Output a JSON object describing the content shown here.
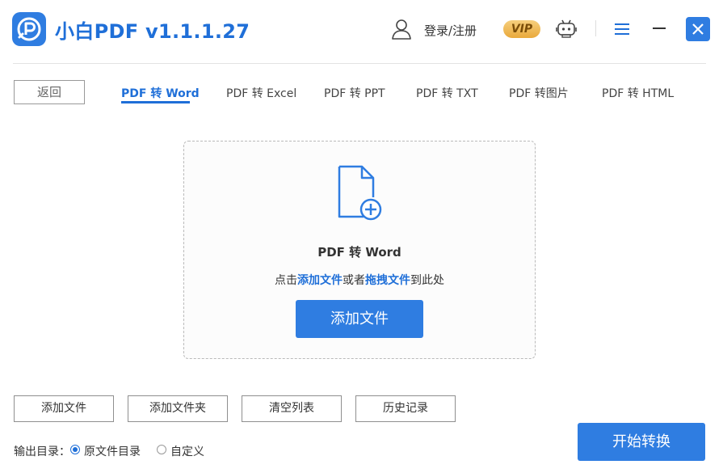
{
  "app": {
    "title": "小白PDF v1.1.1.27"
  },
  "header": {
    "login_label": "登录/注册",
    "vip_label": "VIP"
  },
  "nav": {
    "back_label": "返回",
    "tabs": [
      {
        "label": "PDF 转 Word",
        "active": true
      },
      {
        "label": "PDF 转 Excel",
        "active": false
      },
      {
        "label": "PDF 转 PPT",
        "active": false
      },
      {
        "label": "PDF 转 TXT",
        "active": false
      },
      {
        "label": "PDF 转图片",
        "active": false
      },
      {
        "label": "PDF 转 HTML",
        "active": false
      }
    ]
  },
  "dropzone": {
    "title": "PDF 转 Word",
    "hint_prefix": "点击",
    "hint_add": "添加文件",
    "hint_mid": "或者",
    "hint_drag": "拖拽文件",
    "hint_suffix": "到此处",
    "add_button": "添加文件"
  },
  "actions": {
    "add_file": "添加文件",
    "add_folder": "添加文件夹",
    "clear_list": "清空列表",
    "history": "历史记录"
  },
  "output": {
    "label": "输出目录：",
    "options": [
      {
        "label": "原文件目录",
        "selected": true
      },
      {
        "label": "自定义",
        "selected": false
      }
    ]
  },
  "start_button": "开始转换",
  "colors": {
    "accent": "#2f7de1",
    "title_blue": "#1f6fd8",
    "vip_gold": "#e9a93b"
  },
  "icons": [
    "app-logo-icon",
    "user-icon",
    "robot-icon",
    "menu-icon",
    "minimize-icon",
    "close-icon",
    "file-add-icon"
  ]
}
